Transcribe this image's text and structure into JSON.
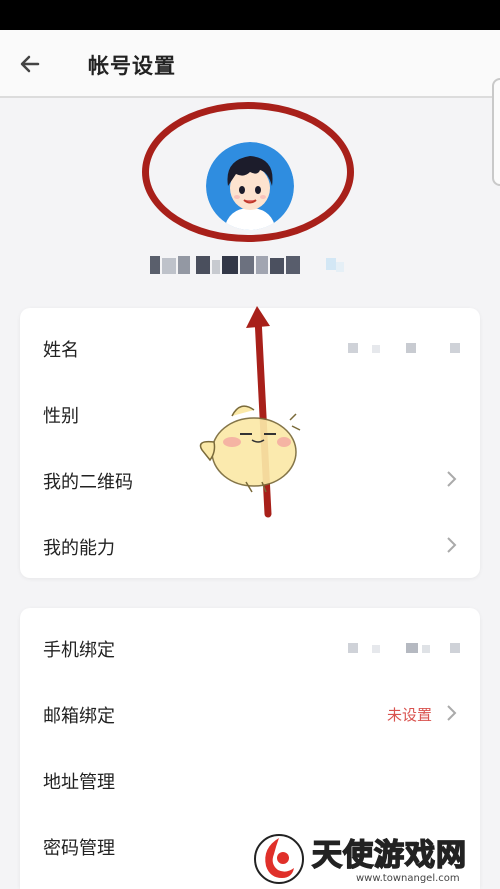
{
  "header": {
    "title": "帐号设置",
    "back_icon": "arrow-left-icon"
  },
  "profile": {
    "avatar_icon": "cartoon-boy-avatar"
  },
  "section1": {
    "rows": [
      {
        "label": "姓名",
        "value_hidden": true,
        "chevron": false
      },
      {
        "label": "性别",
        "chevron": false
      },
      {
        "label": "我的二维码",
        "chevron": true
      },
      {
        "label": "我的能力",
        "chevron": true
      }
    ]
  },
  "section2": {
    "rows": [
      {
        "label": "手机绑定",
        "value_hidden": true,
        "chevron": false
      },
      {
        "label": "邮箱绑定",
        "value": "未设置",
        "chevron": true
      },
      {
        "label": "地址管理",
        "chevron": false
      },
      {
        "label": "密码管理",
        "chevron": false
      }
    ]
  },
  "watermark": {
    "text": "天使游戏网",
    "url": "www.townangel.com"
  },
  "colors": {
    "annotation": "#a8201a",
    "warning_text": "#d9534f",
    "avatar_bg": "#2f8de0"
  }
}
